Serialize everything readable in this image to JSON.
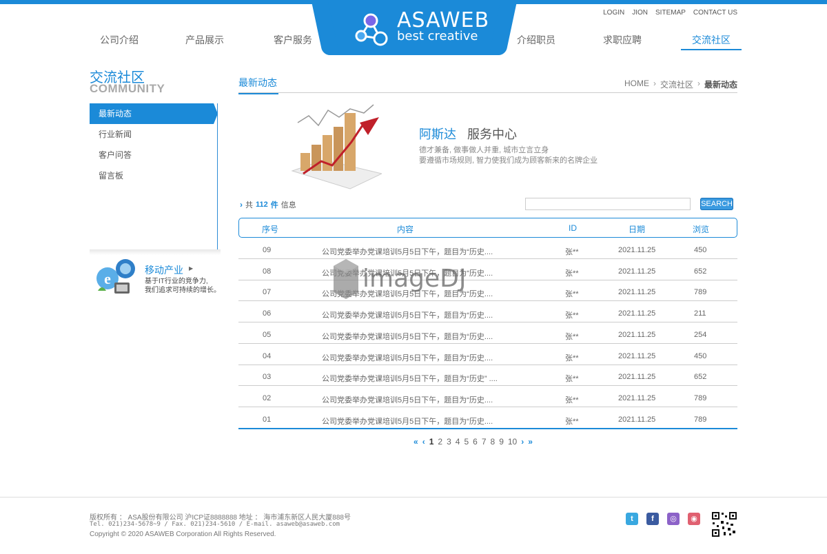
{
  "header": {
    "logo_title": "ASAWEB",
    "logo_subtitle": "best creative",
    "top_links": [
      "LOGIN",
      "JION",
      "SITEMAP",
      "CONTACT US"
    ],
    "nav_left": [
      "公司介绍",
      "产品展示",
      "客户服务"
    ],
    "nav_right": [
      "介绍职员",
      "求职应聘",
      "交流社区"
    ],
    "active_nav": "交流社区",
    "accent_color": "#1b8ad8"
  },
  "sidebar": {
    "title_cn": "交流社区",
    "title_en": "COMMUNITY",
    "items": [
      {
        "label": "最新动态",
        "active": true
      },
      {
        "label": "行业新闻",
        "active": false
      },
      {
        "label": "客户问答",
        "active": false
      },
      {
        "label": "留言板",
        "active": false
      }
    ],
    "promo": {
      "title": "移动产业",
      "line1": "基于IT行业的竞争力,",
      "line2": "我们追求可持续的增长。"
    }
  },
  "main": {
    "section_title": "最新动态",
    "breadcrumb": [
      "HOME",
      "交流社区",
      "最新动态"
    ],
    "service": {
      "name_blue": "阿斯达",
      "name_gray": "服务中心",
      "line1": "德才兼备, 做事做人并重, 城市立言立身",
      "line2": "要遵循市场规则, 智力使我们成为顾客新来的名牌企业"
    },
    "count": {
      "prefix": "共",
      "number": "112",
      "suffix_bold": "件",
      "suffix": "信息"
    },
    "search": {
      "placeholder": "",
      "button": "SEARCH"
    },
    "table": {
      "headers": [
        "序号",
        "内容",
        "ID",
        "日期",
        "浏览"
      ],
      "rows": [
        {
          "no": "09",
          "content": "公司党委举办党课培训5月5日下午，题目为“历史....",
          "id": "张**",
          "date": "2021.11.25",
          "views": "450"
        },
        {
          "no": "08",
          "content": "公司党委举办党课培训5月5日下午，题目为“历史....",
          "id": "张**",
          "date": "2021.11.25",
          "views": "652"
        },
        {
          "no": "07",
          "content": "公司党委举办党课培训5月5日下午，题目为“历史....",
          "id": "张**",
          "date": "2021.11.25",
          "views": "789"
        },
        {
          "no": "06",
          "content": "公司党委举办党课培训5月5日下午，题目为“历史....",
          "id": "张**",
          "date": "2021.11.25",
          "views": "211"
        },
        {
          "no": "05",
          "content": "公司党委举办党课培训5月5日下午，题目为“历史....",
          "id": "张**",
          "date": "2021.11.25",
          "views": "254"
        },
        {
          "no": "04",
          "content": "公司党委举办党课培训5月5日下午，题目为“历史....",
          "id": "张**",
          "date": "2021.11.25",
          "views": "450"
        },
        {
          "no": "03",
          "content": "公司党委举办党课培训5月5日下午，题目为“历史” ....",
          "id": "张**",
          "date": "2021.11.25",
          "views": "652"
        },
        {
          "no": "02",
          "content": "公司党委举办党课培训5月5日下午，题目为“历史....",
          "id": "张**",
          "date": "2021.11.25",
          "views": "789"
        },
        {
          "no": "01",
          "content": "公司党委举办党课培训5月5日下午，题目为“历史....",
          "id": "张**",
          "date": "2021.11.25",
          "views": "789"
        }
      ]
    },
    "pager": {
      "first": "«",
      "prev": "‹",
      "pages": [
        "1",
        "2",
        "3",
        "4",
        "5",
        "6",
        "7",
        "8",
        "9",
        "10"
      ],
      "current": "1",
      "next": "›",
      "last": "»"
    }
  },
  "footer": {
    "line1": "版权所有 ： ASA股份有限公司  沪ICP证8888888    地址 ： 海市浦东新区人民大厦888号",
    "line2": "Tel. 021)234-5678~9  / Fax. 021)234-5610  / E-mail. asaweb@asaweb.com",
    "line3": "Copyright © 2020 ASAWEB Corporation All Rights Reserved.",
    "social_icons": [
      "twitter-icon",
      "facebook-icon",
      "instagram-icon",
      "weibo-icon"
    ]
  },
  "watermark": "imageDJ"
}
